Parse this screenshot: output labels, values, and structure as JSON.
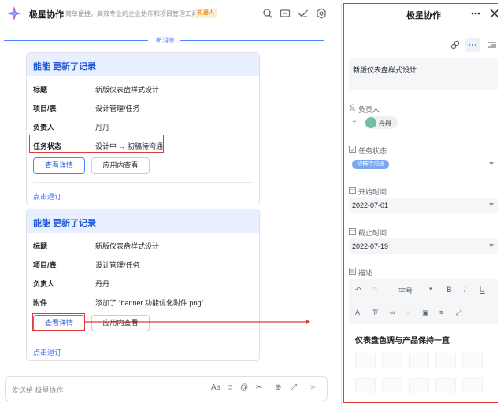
{
  "header": {
    "app_name": "极星协作",
    "description": "简单便捷，高效专业的企业协作和项目管理工具",
    "bot_badge": "机器人"
  },
  "new_messages_label": "新消息",
  "cards": [
    {
      "title": "能能 更新了记录",
      "rows": [
        {
          "key": "标题",
          "value": "新版仪表盘样式设计"
        },
        {
          "key": "项目/表",
          "value": "设计管理/任务"
        },
        {
          "key": "负责人",
          "value": "丹丹"
        },
        {
          "key": "任务状态",
          "value": "设计中 → 初稿待沟通"
        }
      ],
      "primary_button": "查看详情",
      "secondary_button": "应用内查看",
      "unsubscribe": "点击退订"
    },
    {
      "title": "能能 更新了记录",
      "rows": [
        {
          "key": "标题",
          "value": "新版仪表盘样式设计"
        },
        {
          "key": "项目/表",
          "value": "设计管理/任务"
        },
        {
          "key": "负责人",
          "value": "丹丹"
        },
        {
          "key": "附件",
          "value": "添加了 “banner 功能优化附件.png”"
        }
      ],
      "primary_button": "查看详情",
      "secondary_button": "应用内查看",
      "unsubscribe": "点击退订"
    }
  ],
  "composer": {
    "placeholder": "发送给 极星协作",
    "tools": [
      "Aa",
      "☺",
      "@",
      "✂",
      "⊕",
      "⤢",
      "➤"
    ]
  },
  "panel": {
    "title": "极星协作",
    "record_title": "新版仪表盘样式设计",
    "assignee_label": "负责人",
    "assignee_name": "丹丹",
    "status_label": "任务状态",
    "status_value": "初稿待沟通",
    "start_label": "开始时间",
    "start_value": "2022-07-01",
    "due_label": "截止时间",
    "due_value": "2022-07-19",
    "desc_label": "描述",
    "font_size_label": "字号",
    "editor_heading": "仪表盘色调与产品保持一直"
  },
  "colors": {
    "accent": "#245bdb",
    "card_header_bg": "#e8effe",
    "highlight_red": "#e03a3a",
    "status_tag": "#7aa8f5"
  }
}
